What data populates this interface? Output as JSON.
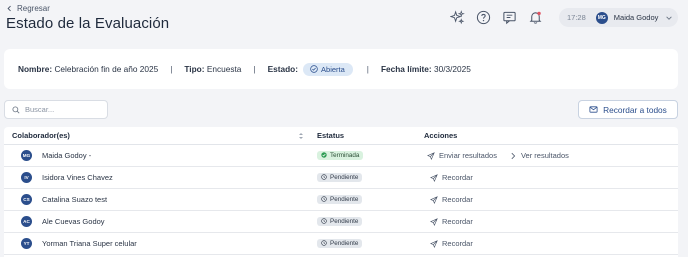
{
  "header": {
    "back_label": "Regresar",
    "title": "Estado de la Evaluación"
  },
  "topbar": {
    "icons": [
      "sparkles-icon",
      "help-icon",
      "feedback-icon",
      "bell-icon"
    ],
    "time": "17:28",
    "user_initials": "MG",
    "user_name": "Maida Godoy"
  },
  "info": {
    "name_label": "Nombre:",
    "name_value": "Celebración fin de año 2025",
    "type_label": "Tipo:",
    "type_value": "Encuesta",
    "state_label": "Estado:",
    "state_value": "Abierta",
    "deadline_label": "Fecha límite:",
    "deadline_value": "30/3/2025",
    "separator": "|"
  },
  "search": {
    "placeholder": "Buscar..."
  },
  "remind_all_label": "Recordar a todos",
  "table": {
    "headers": {
      "collaborator": "Colaborador(es)",
      "status": "Estatus",
      "actions": "Acciones"
    },
    "rows": [
      {
        "initials": "MG",
        "name": "Maida Godoy -",
        "status": "Terminada",
        "status_kind": "done",
        "actions": [
          "Enviar resultados",
          "Ver resultados"
        ]
      },
      {
        "initials": "IV",
        "name": "Isidora Vines Chavez",
        "status": "Pendiente",
        "status_kind": "pending",
        "actions": [
          "Recordar"
        ]
      },
      {
        "initials": "CS",
        "name": "Catalina Suazo test",
        "status": "Pendiente",
        "status_kind": "pending",
        "actions": [
          "Recordar"
        ]
      },
      {
        "initials": "AC",
        "name": "Ale Cuevas Godoy",
        "status": "Pendiente",
        "status_kind": "pending",
        "actions": [
          "Recordar"
        ]
      },
      {
        "initials": "YT",
        "name": "Yorman Triana Super celular",
        "status": "Pendiente",
        "status_kind": "pending",
        "actions": [
          "Recordar"
        ]
      }
    ]
  },
  "colors": {
    "primary": "#2b4e8c",
    "background": "#f3f4f7",
    "done_badge": "#d9f2df",
    "pending_badge": "#e3e7ec",
    "state_badge": "#dce8f6"
  }
}
